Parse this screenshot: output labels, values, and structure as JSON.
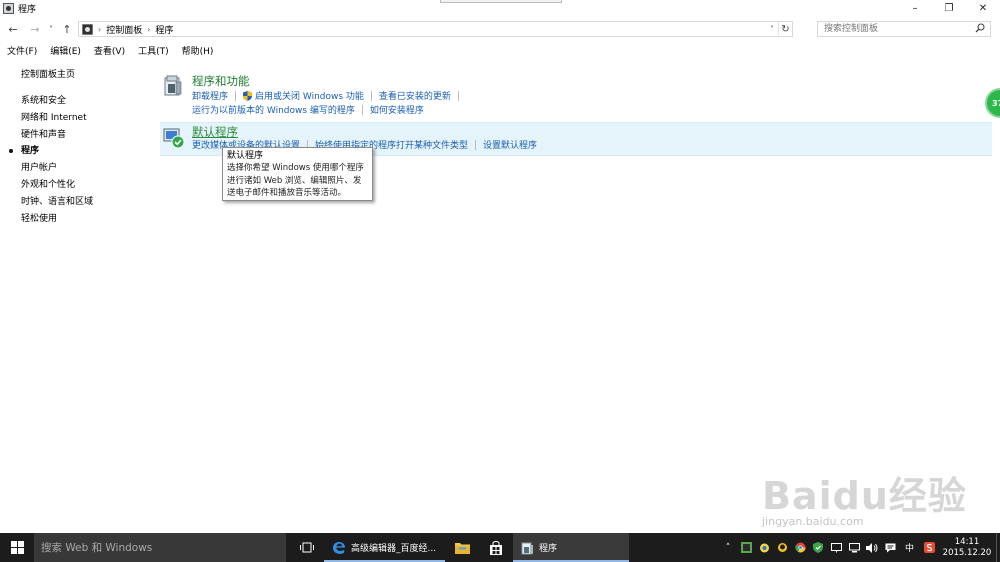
{
  "window": {
    "title": "程序",
    "controls": {
      "minimize": "–",
      "maximize": "❐",
      "close": "✕"
    }
  },
  "nav": {
    "back": "←",
    "forward": "→",
    "recent": "˅",
    "up": "↑",
    "breadcrumbs": [
      "控制面板",
      "程序"
    ],
    "dropdown": "˅",
    "refresh": "↻"
  },
  "search": {
    "placeholder": "搜索控制面板",
    "icon": "search-icon"
  },
  "menu": [
    "文件(F)",
    "编辑(E)",
    "查看(V)",
    "工具(T)",
    "帮助(H)"
  ],
  "sidebar": {
    "home": "控制面板主页",
    "items": [
      "系统和安全",
      "网络和 Internet",
      "硬件和声音",
      "程序",
      "用户帐户",
      "外观和个性化",
      "时钟、语言和区域",
      "轻松使用"
    ],
    "active_index": 3
  },
  "sections": [
    {
      "title": "程序和功能",
      "row1": [
        "卸载程序",
        "启用或关闭 Windows 功能",
        "查看已安装的更新"
      ],
      "row2": [
        "运行为以前版本的 Windows 编写的程序",
        "如何安装程序"
      ]
    },
    {
      "title": "默认程序",
      "row1": [
        "更改媒体或设备的默认设置",
        "始终使用指定的程序打开某种文件类型",
        "设置默认程序"
      ]
    }
  ],
  "tooltip": {
    "title": "默认程序",
    "lines": [
      "选择你希望 Windows 使用哪个程序",
      "进行诸如 Web 浏览、编辑照片、发",
      "送电子邮件和播放音乐等活动。"
    ]
  },
  "badge": {
    "text": "37"
  },
  "watermark": {
    "logo": "Baidu经验",
    "url": "jingyan.baidu.com"
  },
  "taskbar": {
    "search_placeholder": "搜索 Web 和 Windows",
    "apps": [
      {
        "label": "高级编辑器_百度经...",
        "icon": "edge-icon"
      },
      {
        "label": "",
        "icon": "file-explorer-icon"
      },
      {
        "label": "",
        "icon": "store-icon"
      },
      {
        "label": "程序",
        "icon": "control-panel-icon"
      }
    ],
    "tray_ime": "中",
    "clock_time": "14:11",
    "clock_date": "2015.12.20"
  },
  "colors": {
    "link": "#1a5fb4",
    "section_title": "#1e7d32",
    "highlight": "#e5f3fb",
    "taskbar": "#1c1c1c"
  }
}
